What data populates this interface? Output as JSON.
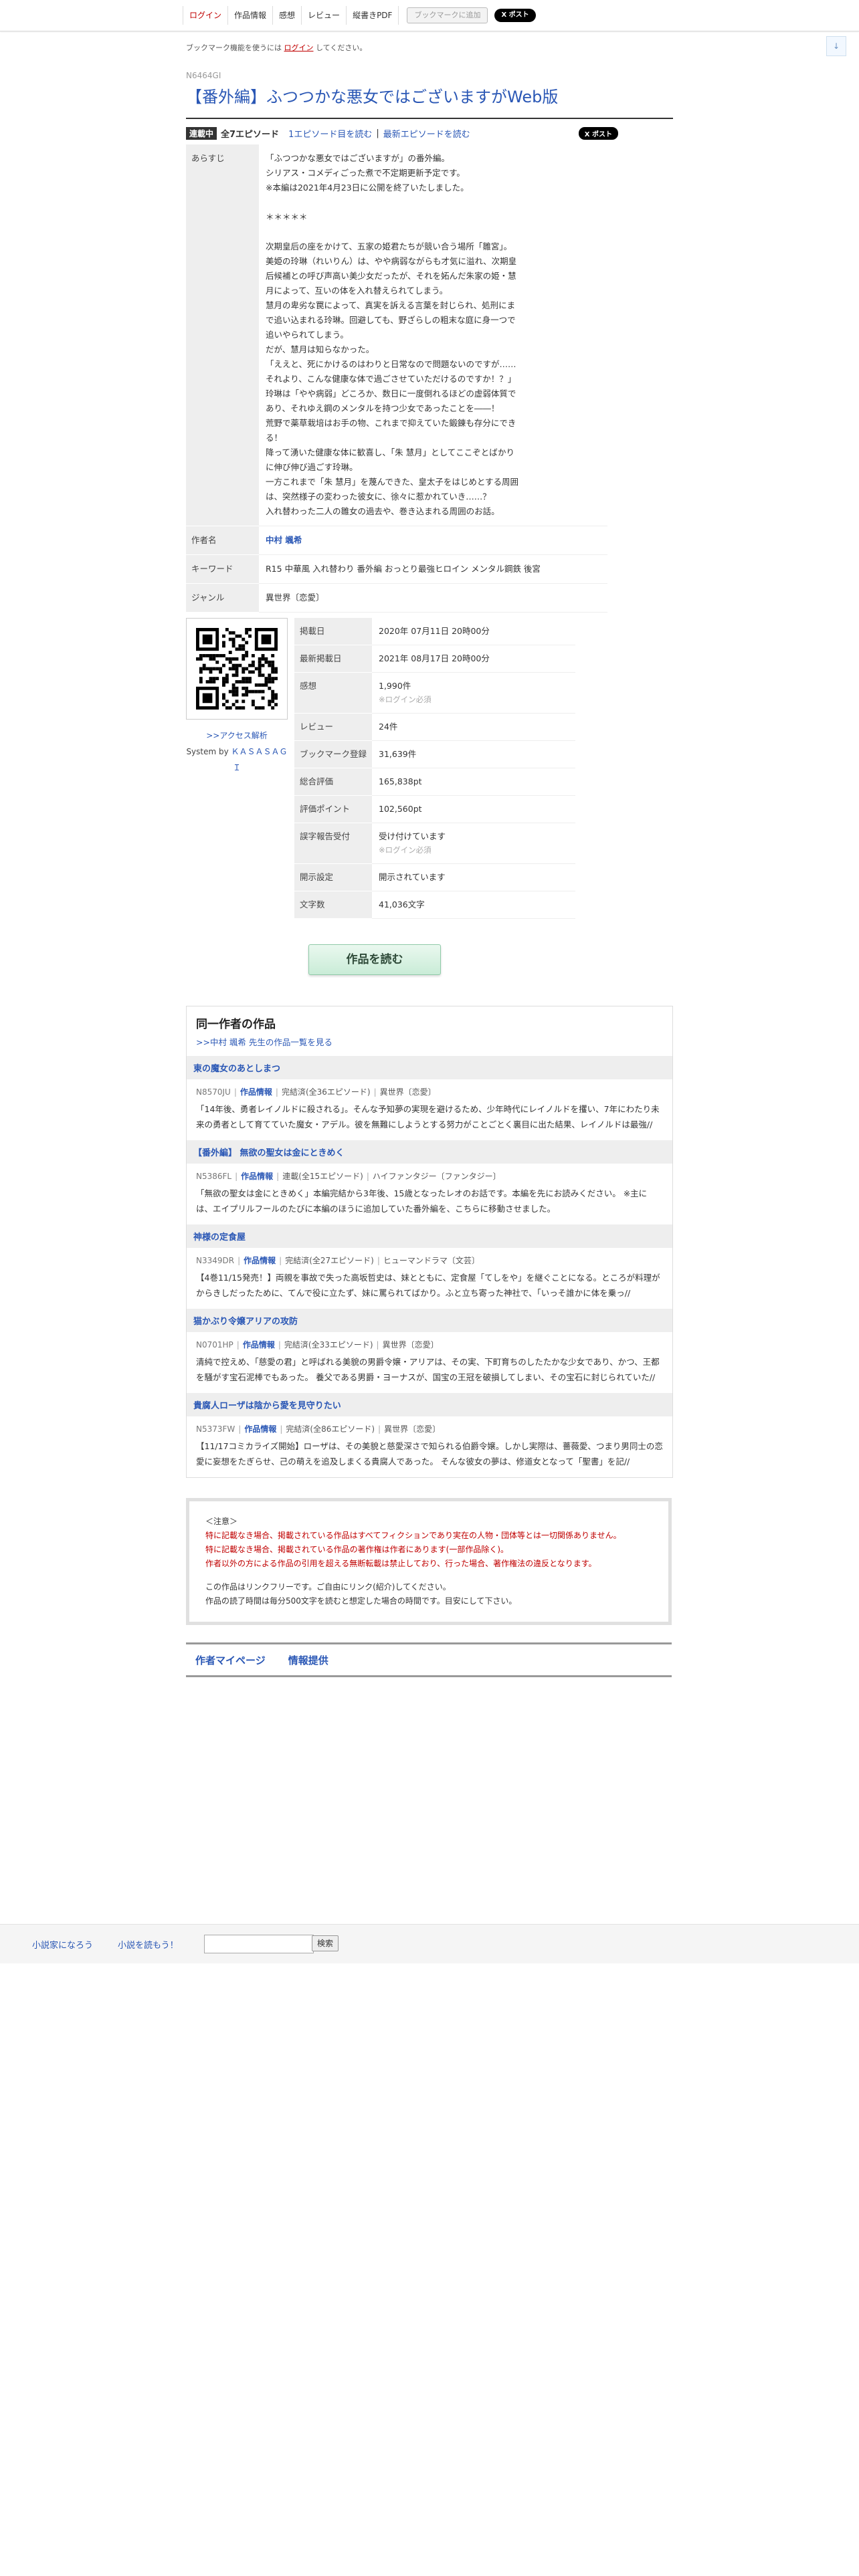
{
  "nav": {
    "login": "ログイン",
    "work_info": "作品情報",
    "impressions": "感想",
    "review": "レビュー",
    "pdf": "縦書きPDF",
    "bookmark": "ブックマークに追加",
    "x_post": "X ポスト"
  },
  "side_button": "↓",
  "login_note": {
    "prefix": "ブックマーク機能を使うには ",
    "link": "ログイン",
    "suffix": " してください。"
  },
  "ncode": "N6464GI",
  "title": "【番外編】ふつつかな悪女ではございますがWeb版",
  "status": {
    "badge": "連載中",
    "episodes": "全7エピソード",
    "first_ep": "1エピソード目を読む",
    "separator": "|",
    "latest_ep": "最新エピソードを読む",
    "x_post": "X ポスト"
  },
  "info": {
    "synopsis_label": "あらすじ",
    "synopsis": [
      "「ふつつかな悪女ではございますが」の番外編。",
      "シリアス・コメディごった煮で不定期更新予定です。",
      "※本編は2021年4月23日に公開を終了いたしました。",
      "",
      "＊＊＊＊＊",
      "",
      "次期皇后の座をかけて、五家の姫君たちが競い合う場所「雛宮」。",
      "美姫の玲琳（れいりん）は、やや病弱ながらも才気に溢れ、次期皇",
      "后候補との呼び声高い美少女だったが、それを妬んだ朱家の姫・慧",
      "月によって、互いの体を入れ替えられてしまう。",
      "慧月の卑劣な罠によって、真実を訴える言葉を封じられ、処刑にま",
      "で追い込まれる玲琳。回避しても、野ざらしの粗末な庭に身一つで",
      "追いやられてしまう。",
      "だが、慧月は知らなかった。",
      "「ええと、死にかけるのはわりと日常なので問題ないのですが……",
      "それより、こんな健康な体で過ごさせていただけるのですか！？」",
      "玲琳は「やや病弱」どころか、数日に一度倒れるほどの虚弱体質で",
      "あり、それゆえ鋼のメンタルを持つ少女であったことを――！",
      "荒野で薬草栽培はお手の物、これまで抑えていた鍛錬も存分にでき",
      "る！",
      "降って湧いた健康な体に歓喜し、「朱 慧月」としてここぞとばかり",
      "に伸び伸び過ごす玲琳。",
      "一方これまで「朱 慧月」を蔑んできた、皇太子をはじめとする周囲",
      "は、突然様子の変わった彼女に、徐々に惹かれていき……？",
      "入れ替わった二人の雛女の過去や、巻き込まれる周囲のお話。"
    ],
    "author_label": "作者名",
    "author": "中村 颯希",
    "keywords_label": "キーワード",
    "keywords": "R15  中華風 入れ替わり 番外編 おっとり最強ヒロイン メンタル鋼鉄 後宮",
    "genre_label": "ジャンル",
    "genre": "異世界〔恋愛〕"
  },
  "qr": {
    "access_link": ">>アクセス解析",
    "system_by": "System by ",
    "system_name": "ＫＡＳＡＳＡＧＩ"
  },
  "stats": [
    {
      "label": "掲載日",
      "value": "2020年 07月11日 20時00分",
      "sub": ""
    },
    {
      "label": "最新掲載日",
      "value": "2021年 08月17日 20時00分",
      "sub": ""
    },
    {
      "label": "感想",
      "value": "1,990件",
      "sub": "※ログイン必須"
    },
    {
      "label": "レビュー",
      "value": "24件",
      "sub": ""
    },
    {
      "label": "ブックマーク登録",
      "value": "31,639件",
      "sub": ""
    },
    {
      "label": "総合評価",
      "value": "165,838pt",
      "sub": ""
    },
    {
      "label": "評価ポイント",
      "value": "102,560pt",
      "sub": ""
    },
    {
      "label": "誤字報告受付",
      "value": "受け付けています",
      "sub": "※ログイン必須"
    },
    {
      "label": "開示設定",
      "value": "開示されています",
      "sub": ""
    },
    {
      "label": "文字数",
      "value": "41,036文字",
      "sub": ""
    }
  ],
  "read_button": "作品を読む",
  "others": {
    "heading": "同一作者の作品",
    "all_link": ">>中村 颯希 先生の作品一覧を見る",
    "items": [
      {
        "title": "東の魔女のあとしまつ",
        "ncode": "N8570JU",
        "info": "作品情報",
        "status": "完結済(全36エピソード)",
        "genre": "異世界〔恋愛〕",
        "desc": "「14年後、勇者レイノルドに殺される」。そんな予知夢の実現を避けるため、少年時代にレイノルドを攫い、7年にわたり未来の勇者として育てていた魔女・アデル。彼を無難にしようとする努力がことごとく裏目に出た結果、レイノルドは最強//"
      },
      {
        "title": "【番外編】 無欲の聖女は金にときめく",
        "ncode": "N5386FL",
        "info": "作品情報",
        "status": "連載(全15エピソード)",
        "genre": "ハイファンタジー〔ファンタジー〕",
        "desc": "「無欲の聖女は金にときめく」本編完結から3年後、15歳となったレオのお話です。本編を先にお読みください。 ※主には、エイプリルフールのたびに本編のほうに追加していた番外編を、こちらに移動させました。"
      },
      {
        "title": "神様の定食屋",
        "ncode": "N3349DR",
        "info": "作品情報",
        "status": "完結済(全27エピソード)",
        "genre": "ヒューマンドラマ〔文芸〕",
        "desc": "【4巻11/15発売！】両親を事故で失った高坂哲史は、妹とともに、定食屋「てしをや」を継ぐことになる。ところが料理がからきしだったために、てんで役に立たず、妹に罵られてばかり。ふと立ち寄った神社で、「いっそ誰かに体を乗っ//"
      },
      {
        "title": "猫かぶり令嬢アリアの攻防",
        "ncode": "N0701HP",
        "info": "作品情報",
        "status": "完結済(全33エピソード)",
        "genre": "異世界〔恋愛〕",
        "desc": "清純で控えめ、「慈愛の君」と呼ばれる美貌の男爵令嬢・アリアは、その実、下町育ちのしたたかな少女であり、かつ、王都を騒がす宝石泥棒でもあった。 養父である男爵・ヨーナスが、国宝の王冠を破損してしまい、その宝石に封じられていた//"
      },
      {
        "title": "貴腐人ローザは陰から愛を見守りたい",
        "ncode": "N5373FW",
        "info": "作品情報",
        "status": "完結済(全86エピソード)",
        "genre": "異世界〔恋愛〕",
        "desc": "【11/17コミカライズ開始】ローザは、その美貌と慈愛深さで知られる伯爵令嬢。しかし実際は、薔薇愛、つまり男同士の恋愛に妄想をたぎらせ、己の萌えを追及しまくる貴腐人であった。 そんな彼女の夢は、修道女となって「聖書」を記//"
      }
    ]
  },
  "notice": {
    "header": "＜注意＞",
    "red_lines": [
      "特に記載なき場合、掲載されている作品はすべてフィクションであり実在の人物・団体等とは一切関係ありません。",
      "特に記載なき場合、掲載されている作品の著作権は作者にあります(一部作品除く)。",
      "作者以外の方による作品の引用を超える無断転載は禁止しており、行った場合、著作権法の違反となります。"
    ],
    "lines": [
      "この作品はリンクフリーです。ご自由にリンク(紹介)してください。",
      "作品の読了時間は毎分500文字を読むと想定した場合の時間です。目安にして下さい。"
    ]
  },
  "bottom_nav": {
    "mypage": "作者マイページ",
    "info": "情報提供"
  },
  "footer": {
    "narou": "小説家になろう",
    "yomou": "小説を読もう！",
    "search_btn": "検索",
    "search_value": ""
  }
}
